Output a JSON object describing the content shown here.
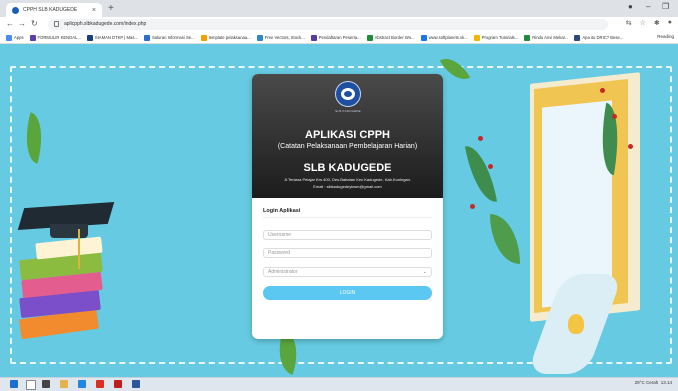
{
  "browser": {
    "tab_title": "CPPH SLB KADUGEDE",
    "tab_close": "×",
    "new_tab": "+",
    "url": "aplicpph.slbkadugede.com/index.php",
    "bookmarks": [
      {
        "label": "Apps",
        "color": "#4a8af4"
      },
      {
        "label": "FORMULIR KENDAL...",
        "color": "#5a3ea8"
      },
      {
        "label": "SIAMAN DTKP | Mas...",
        "color": "#1a3f80"
      },
      {
        "label": "Saluran Informasi Se...",
        "color": "#2b6dd1"
      },
      {
        "label": "template pelaksanaa...",
        "color": "#f4a000"
      },
      {
        "label": "Free Vectors, Stock...",
        "color": "#2c88c9"
      },
      {
        "label": "Pendaftaran Peserta...",
        "color": "#5b3aa0"
      },
      {
        "label": "Abstract Border Wo...",
        "color": "#1e8c3a"
      },
      {
        "label": "www.softplanets.vk...",
        "color": "#1a73e8"
      },
      {
        "label": "Program Tutorials...",
        "color": "#f4b400"
      },
      {
        "label": "Rindu Anvi Mekar...",
        "color": "#1e8c3a"
      },
      {
        "label": "Apa itu DRIC? Bese...",
        "color": "#2d4a7a"
      }
    ],
    "reading_list": "Reading"
  },
  "card": {
    "logo_caption": "SLB KADUGEDE",
    "title": "APLIKASI CPPH",
    "subtitle": "(Catatan Pelaksanaan Pembelajaran Harian)",
    "school": "SLB KADUGEDE",
    "address": "Jl.Tentara Pelajar Km.400, Des.Babatan Kec.Kadugede, Kab.Kuningan.",
    "email": "Email : slbkadugedeykwm@gmail.com",
    "login_title": "Login Aplikasi",
    "username_placeholder": "Username",
    "password_placeholder": "Password",
    "role_selected": "Administrator",
    "login_button": "LOGIN"
  },
  "taskbar": {
    "weather": "29°C Cerah",
    "time": "13.14",
    "date": "..."
  },
  "colors": {
    "page_bg": "#66cbe2",
    "login_button": "#5bc8f2",
    "header_dark": "#1c1c1c"
  }
}
